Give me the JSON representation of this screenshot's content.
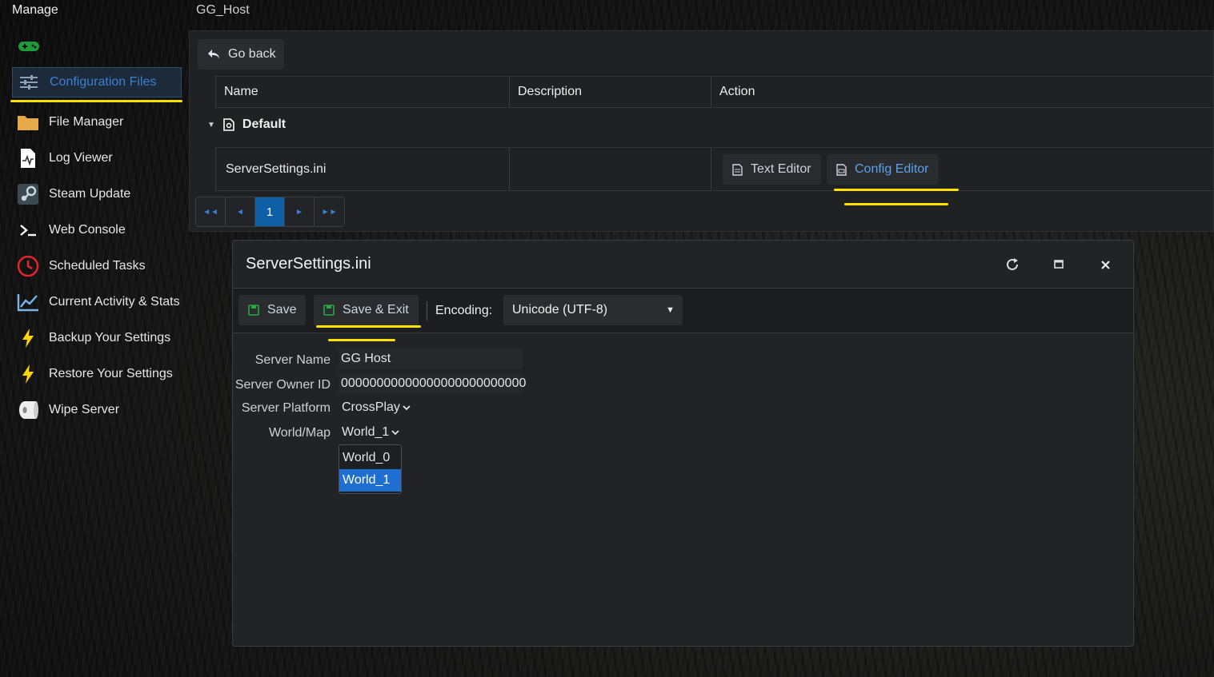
{
  "top": {
    "manage": "Manage",
    "server_title": "GG_Host"
  },
  "sidebar": {
    "items": [
      {
        "label": "Configuration Files",
        "icon": "sliders-icon"
      },
      {
        "label": "File Manager",
        "icon": "folder-icon"
      },
      {
        "label": "Log Viewer",
        "icon": "log-file-icon"
      },
      {
        "label": "Steam Update",
        "icon": "steam-icon"
      },
      {
        "label": "Web Console",
        "icon": "terminal-icon"
      },
      {
        "label": "Scheduled Tasks",
        "icon": "clock-icon"
      },
      {
        "label": "Current Activity & Stats",
        "icon": "chart-icon"
      },
      {
        "label": "Backup Your Settings",
        "icon": "bolt-icon"
      },
      {
        "label": "Restore Your Settings",
        "icon": "bolt-icon"
      },
      {
        "label": "Wipe Server",
        "icon": "wipe-icon"
      }
    ]
  },
  "panel": {
    "go_back": "Go back",
    "columns": [
      "Name",
      "Description",
      "Action"
    ],
    "group": "Default",
    "row": {
      "name": "ServerSettings.ini",
      "description": "",
      "text_editor": "Text Editor",
      "config_editor": "Config Editor"
    },
    "pager": {
      "current": "1"
    }
  },
  "dialog": {
    "title": "ServerSettings.ini",
    "toolbar": {
      "save": "Save",
      "save_exit": "Save & Exit",
      "encoding_label": "Encoding:",
      "encoding_value": "Unicode (UTF-8)"
    },
    "fields": {
      "server_name": {
        "label": "Server Name",
        "value": "GG Host"
      },
      "owner_id": {
        "label": "Server Owner ID",
        "value": "00000000000000000000000000"
      },
      "platform": {
        "label": "Server Platform",
        "value": "CrossPlay"
      },
      "world": {
        "label": "World/Map",
        "value": "World_1",
        "options": [
          "World_0",
          "World_1"
        ]
      }
    }
  },
  "colors": {
    "accent": "#3a7fd4",
    "highlight": "#ffe100",
    "selected": "#1f6fd1",
    "save_green": "#28a745"
  }
}
